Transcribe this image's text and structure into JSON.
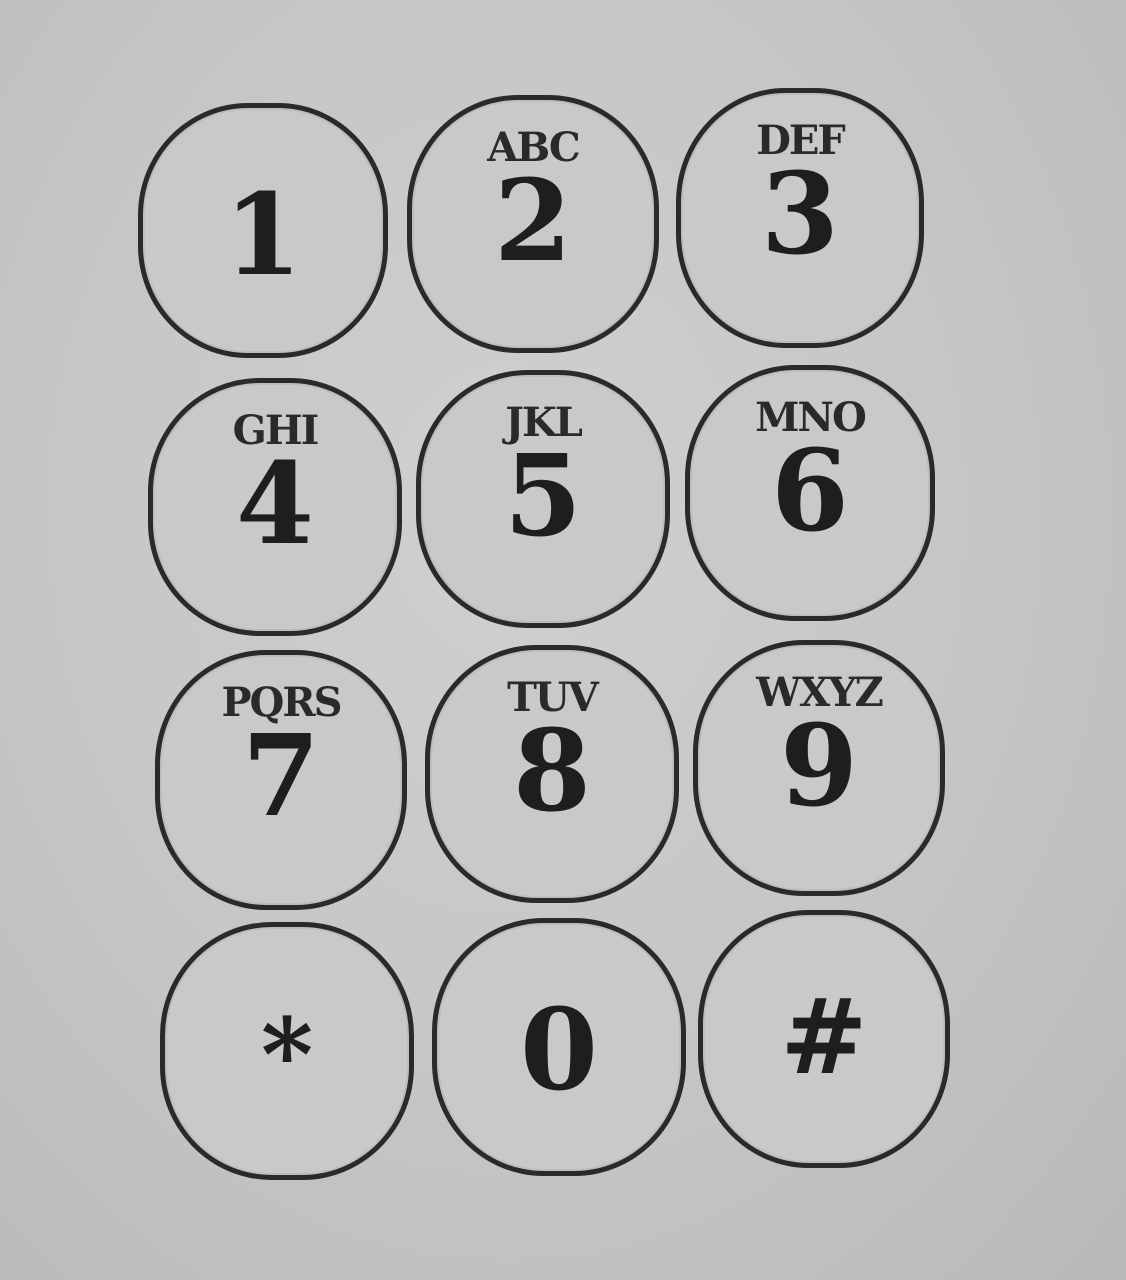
{
  "keypad": {
    "keys": [
      {
        "digit": "1",
        "letters": ""
      },
      {
        "digit": "2",
        "letters": "ABC"
      },
      {
        "digit": "3",
        "letters": "DEF"
      },
      {
        "digit": "4",
        "letters": "GHI"
      },
      {
        "digit": "5",
        "letters": "JKL"
      },
      {
        "digit": "6",
        "letters": "MNO"
      },
      {
        "digit": "7",
        "letters": "PQRS"
      },
      {
        "digit": "8",
        "letters": "TUV"
      },
      {
        "digit": "9",
        "letters": "WXYZ"
      },
      {
        "digit": "*",
        "letters": ""
      },
      {
        "digit": "0",
        "letters": ""
      },
      {
        "digit": "#",
        "letters": ""
      }
    ]
  },
  "colors": {
    "background": "#c4c4c6",
    "key_fill": "#c9c9cb",
    "key_outline": "#2a2a2a",
    "text": "#1e1e1e"
  }
}
